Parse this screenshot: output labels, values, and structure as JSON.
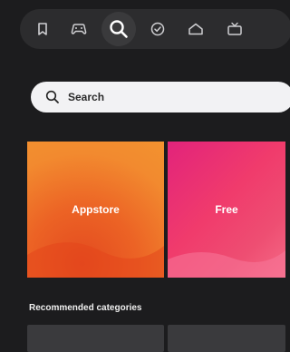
{
  "nav": {
    "items": [
      {
        "icon": "bookmark-icon"
      },
      {
        "icon": "gamepad-icon"
      },
      {
        "icon": "search-icon",
        "active": true
      },
      {
        "icon": "check-circle-icon"
      },
      {
        "icon": "home-icon"
      },
      {
        "icon": "tv-icon"
      }
    ]
  },
  "search": {
    "placeholder": "Search"
  },
  "tiles": [
    {
      "label": "Appstore",
      "color": "#f08a2c"
    },
    {
      "label": "Free",
      "color": "#e9306f"
    }
  ],
  "sections": {
    "recommended_title": "Recommended categories"
  },
  "colors": {
    "background": "#1c1c1e",
    "nav_bar": "#2c2c2e",
    "search_bar": "#f2f2f4"
  }
}
